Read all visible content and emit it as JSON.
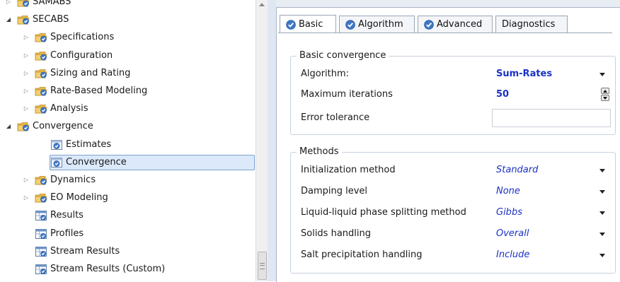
{
  "tree": {
    "items": [
      {
        "label": "SAMABS",
        "toggle": "collapsed",
        "icon": "folder-check-icon"
      },
      {
        "label": "SECABS",
        "toggle": "expanded",
        "icon": "folder-check-icon"
      },
      {
        "label": "Specifications",
        "toggle": "collapsed",
        "icon": "folder-check-icon"
      },
      {
        "label": "Configuration",
        "toggle": "collapsed",
        "icon": "folder-check-icon"
      },
      {
        "label": "Sizing and Rating",
        "toggle": "collapsed",
        "icon": "folder-check-icon"
      },
      {
        "label": "Rate-Based Modeling",
        "toggle": "collapsed",
        "icon": "folder-check-icon"
      },
      {
        "label": "Analysis",
        "toggle": "collapsed",
        "icon": "folder-check-icon"
      },
      {
        "label": "Convergence",
        "toggle": "expanded",
        "icon": "folder-check-icon"
      },
      {
        "label": "Estimates",
        "toggle": "none",
        "icon": "form-check-icon"
      },
      {
        "label": "Convergence",
        "toggle": "none",
        "icon": "form-check-icon",
        "selected": true
      },
      {
        "label": "Dynamics",
        "toggle": "collapsed",
        "icon": "folder-check-icon"
      },
      {
        "label": "EO Modeling",
        "toggle": "collapsed",
        "icon": "folder-check-icon"
      },
      {
        "label": "Results",
        "toggle": "none",
        "icon": "results-table-icon"
      },
      {
        "label": "Profiles",
        "toggle": "none",
        "icon": "results-table-icon"
      },
      {
        "label": "Stream Results",
        "toggle": "none",
        "icon": "results-table-icon"
      },
      {
        "label": "Stream Results (Custom)",
        "toggle": "none",
        "icon": "results-table-icon"
      }
    ]
  },
  "tabs": [
    {
      "label": "Basic",
      "checked": true,
      "active": true
    },
    {
      "label": "Algorithm",
      "checked": true,
      "active": false
    },
    {
      "label": "Advanced",
      "checked": true,
      "active": false
    },
    {
      "label": "Diagnostics",
      "checked": false,
      "active": false
    }
  ],
  "basic_convergence": {
    "title": "Basic convergence",
    "algorithm_label": "Algorithm:",
    "algorithm_value": "Sum-Rates",
    "max_iter_label": "Maximum iterations",
    "max_iter_value": "50",
    "error_tol_label": "Error tolerance",
    "error_tol_value": ""
  },
  "methods": {
    "title": "Methods",
    "rows": [
      {
        "label": "Initialization method",
        "value": "Standard"
      },
      {
        "label": "Damping level",
        "value": "None"
      },
      {
        "label": "Liquid-liquid phase splitting method",
        "value": "Gibbs"
      },
      {
        "label": "Solids handling",
        "value": "Overall"
      },
      {
        "label": "Salt precipitation handling",
        "value": "Include"
      }
    ]
  },
  "colors": {
    "accent_blue": "#1b32c5",
    "selection": "#dbe9fb",
    "panel_bg": "#dfe7f2"
  }
}
